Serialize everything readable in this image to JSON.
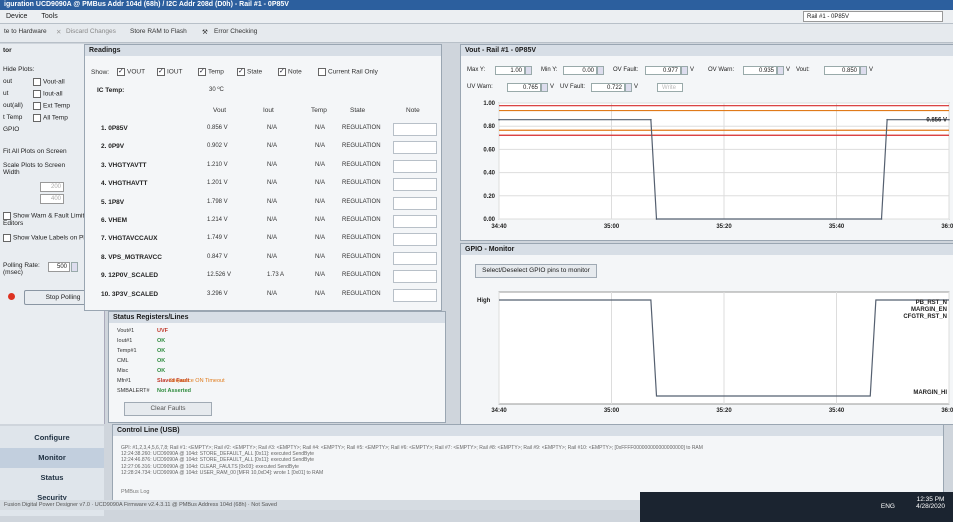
{
  "window": {
    "title": "iguration UCD9090A @ PMBus Addr 104d (68h) / I2C Addr 208d (D0h) - Rail #1 - 0P85V"
  },
  "menu": [
    "Device",
    "Tools"
  ],
  "rail_selector": "Rail #1 - 0P85V",
  "toolbar": {
    "write_hw": "te to Hardware",
    "discard": "Discard Changes",
    "store_flash": "Store RAM to Flash",
    "error_checking": "Error Checking"
  },
  "left": {
    "header": "tor",
    "hide_plots": "Hide Plots:",
    "checks": [
      {
        "a": "out",
        "b": "Vout-all"
      },
      {
        "a": "ut",
        "b": "Iout-all"
      },
      {
        "a": "out(all)",
        "b": "Ext Temp"
      },
      {
        "a": "t Temp",
        "b": "All Temp"
      }
    ],
    "gpio": "GPIO",
    "fit_all": "Fit All Plots on Screen",
    "scale_plots": "Scale Plots to Screen Width",
    "scale_val1": "200",
    "scale_val2": "400",
    "show_warn": "Show Warn & Fault Limit Editors",
    "show_value": "Show Value Labels on Plots",
    "polling_rate": "Polling Rate: (msec)",
    "polling_val": "500",
    "stop_polling": "Stop Polling"
  },
  "nav": [
    "Configure",
    "Monitor",
    "Status",
    "Security"
  ],
  "readings": {
    "title": "Readings",
    "show_label": "Show:",
    "show_opts": [
      "VOUT",
      "IOUT",
      "Temp",
      "State",
      "Note",
      "Current Rail Only"
    ],
    "ic_temp_label": "IC Temp:",
    "ic_temp_val": "30 ºC",
    "cols": [
      "Vout",
      "Iout",
      "Temp",
      "State",
      "Note"
    ],
    "rows": [
      {
        "name": "1. 0P85V",
        "vout": "0.856 V",
        "iout": "N/A",
        "temp": "N/A",
        "state": "REGULATION"
      },
      {
        "name": "2. 0P9V",
        "vout": "0.902 V",
        "iout": "N/A",
        "temp": "N/A",
        "state": "REGULATION"
      },
      {
        "name": "3. VHGTYAVTT",
        "vout": "1.210 V",
        "iout": "N/A",
        "temp": "N/A",
        "state": "REGULATION"
      },
      {
        "name": "4. VHGTHAVTT",
        "vout": "1.201 V",
        "iout": "N/A",
        "temp": "N/A",
        "state": "REGULATION"
      },
      {
        "name": "5. 1P8V",
        "vout": "1.798 V",
        "iout": "N/A",
        "temp": "N/A",
        "state": "REGULATION"
      },
      {
        "name": "6. VHEM",
        "vout": "1.214 V",
        "iout": "N/A",
        "temp": "N/A",
        "state": "REGULATION"
      },
      {
        "name": "7. VHGTAVCCAUX",
        "vout": "1.749 V",
        "iout": "N/A",
        "temp": "N/A",
        "state": "REGULATION"
      },
      {
        "name": "8. VPS_MGTRAVCC",
        "vout": "0.847 V",
        "iout": "N/A",
        "temp": "N/A",
        "state": "REGULATION"
      },
      {
        "name": "9. 12P0V_SCALED",
        "vout": "12.526 V",
        "iout": "1.73 A",
        "temp": "N/A",
        "state": "REGULATION"
      },
      {
        "name": "10. 3P3V_SCALED",
        "vout": "3.296 V",
        "iout": "N/A",
        "temp": "N/A",
        "state": "REGULATION"
      }
    ]
  },
  "status": {
    "title": "Status Registers/Lines",
    "rows": [
      {
        "k": "Vout#1",
        "v": "UVF",
        "color": "#c0392b"
      },
      {
        "k": "Iout#1",
        "v": "OK",
        "color": "#2e8b3d"
      },
      {
        "k": "Temp#1",
        "v": "OK",
        "color": "#2e8b3d"
      },
      {
        "k": "CML",
        "v": "OK",
        "color": "#2e8b3d"
      },
      {
        "k": "Misc",
        "v": "OK",
        "color": "#2e8b3d"
      },
      {
        "k": "Mfr#1",
        "v": "Slaved Fault",
        "color": "#c0392b"
      },
      {
        "k": "SMBALERT#",
        "v": "Not Asserted",
        "color": "#2e8b3d"
      }
    ],
    "mfr_extra": "Sequence ON Timeout",
    "clear_faults": "Clear Faults"
  },
  "control": {
    "title": "Control Line (USB)",
    "log": [
      "GPI: #1,2,3,4,5,6,7,8; Rail #1: <EMPTY>; Rail #2: <EMPTY>; Rail #3: <EMPTY>; Rail #4: <EMPTY>; Rail #5: <EMPTY>; Rail #6: <EMPTY>; Rail #7: <EMPTY>; Rail #8: <EMPTY>; Rail #9: <EMPTY>; Rail #10: <EMPTY>; [0xFFFF000000000000000000] to RAM",
      "12:24:38.260: UCD9090A @ 104d: STORE_DEFAULT_ALL [0x11]: executed SendByte",
      "12:24:46.876: UCD9090A @ 104d: STORE_DEFAULT_ALL [0x11]: executed SendByte",
      "12:27:06.316: UCD9090A @ 104d: CLEAR_FAULTS [0x03]: executed SendByte",
      "12:28:24.734: UCD9090A @ 104d: USER_RAM_00 [MFR 10,0xD4]: wrote 1 [0x01] to RAM"
    ],
    "pmbus_log": "PMBus Log"
  },
  "vout": {
    "title": "Vout - Rail #1 - 0P85V",
    "max_y_label": "Max Y:",
    "max_y": "1.00",
    "min_y_label": "Min Y:",
    "min_y": "0.00",
    "ov_fault_label": "OV Fault:",
    "ov_fault": "0.977",
    "ov_warn_label": "OV Warn:",
    "ov_warn": "0.935",
    "vout_label": "Vout:",
    "vout_val": "0.850",
    "uv_warn_label": "UV Warn:",
    "uv_warn": "0.765",
    "uv_fault_label": "UV Fault:",
    "uv_fault": "0.722",
    "unit": "V",
    "write_btn": "Write"
  },
  "gpio": {
    "title": "GPIO - Monitor",
    "select_btn": "Select/Deselect GPIO pins to monitor",
    "high": "High",
    "signals": [
      "PB_RST_N",
      "MARGIN_EN",
      "CFGTR_RST_N"
    ],
    "margin_hi": "MARGIN_HI"
  },
  "chart_data": [
    {
      "type": "line",
      "title": "",
      "xlabel": "",
      "ylabel": "",
      "x_ticks": [
        "34:40",
        "35:00",
        "35:20",
        "35:40",
        "36:00"
      ],
      "y_ticks": [
        "0.00",
        "0.20",
        "0.40",
        "0.60",
        "0.80",
        "1.00"
      ],
      "ylim": [
        0,
        1.0
      ],
      "xlim": [
        0,
        80
      ],
      "series": [
        {
          "x": [
            0,
            27,
            28,
            68,
            69,
            80
          ],
          "values": [
            0.856,
            0.856,
            0.0,
            0.0,
            0.856,
            0.856
          ],
          "color": "#556070"
        }
      ],
      "limits": [
        {
          "value": 0.977,
          "color": "#d42a2a"
        },
        {
          "value": 0.935,
          "color": "#e07a1a"
        },
        {
          "value": 0.765,
          "color": "#e07a1a"
        },
        {
          "value": 0.722,
          "color": "#d42a2a"
        }
      ],
      "last_value_label": "0.856 V"
    },
    {
      "type": "line",
      "title": "",
      "xlabel": "",
      "ylabel": "",
      "x_ticks": [
        "34:40",
        "35:00",
        "35:20",
        "35:40",
        "36:00"
      ],
      "y_ticks": [
        "High"
      ],
      "series": [
        {
          "x": [
            0,
            27,
            28,
            66,
            67,
            80
          ],
          "values": [
            1,
            1,
            0,
            0,
            1,
            1
          ],
          "color": "#556070"
        }
      ]
    }
  ],
  "statusbar": "Fusion Digital Power Designer v7.0 · UCD9090A Firmware v2.4.3.11 @ PMBus Address 104d (68h) · Not Saved",
  "taskbar": {
    "lang": "ENG",
    "time": "12:35 PM",
    "date": "4/28/2020"
  }
}
